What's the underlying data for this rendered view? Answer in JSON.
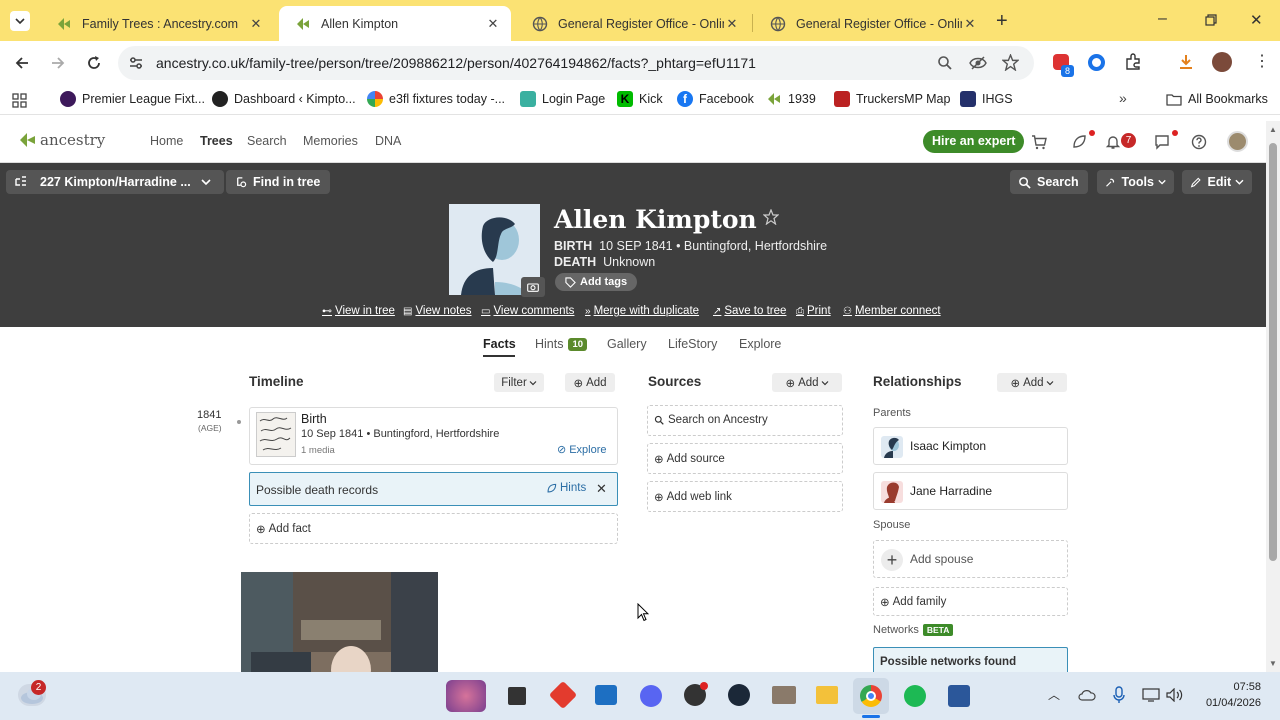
{
  "browser": {
    "tabs": [
      {
        "title": "Family Trees : Ancestry.com"
      },
      {
        "title": "Allen Kimpton"
      },
      {
        "title": "General Register Office - Online"
      },
      {
        "title": "General Register Office - Online"
      }
    ],
    "url": "ancestry.co.uk/family-tree/person/tree/209886212/person/402764194862/facts?_phtarg=efU1171",
    "extensions_badge": "8",
    "bookmarks": [
      "Premier League Fixt...",
      "Dashboard ‹ Kimpto...",
      "e3fl fixtures today -...",
      "Login Page",
      "Kick",
      "Facebook",
      "1939",
      "TruckersMP Map",
      "IHGS"
    ],
    "all_bookmarks": "All Bookmarks"
  },
  "ancestry": {
    "logo": "ancestry",
    "nav": [
      "Home",
      "Trees",
      "Search",
      "Memories",
      "DNA"
    ],
    "hire_expert": "Hire an expert",
    "notif_count": "7"
  },
  "hero": {
    "tree_name": "227 Kimpton/Harradine ...",
    "find_in_tree": "Find in tree",
    "search": "Search",
    "tools": "Tools",
    "edit": "Edit",
    "name": "Allen Kimpton",
    "birth_label": "BIRTH",
    "birth_value": "10 SEP 1841 • Buntingford, Hertfordshire",
    "death_label": "DEATH",
    "death_value": "Unknown",
    "add_tags": "Add tags",
    "links": [
      "View in tree",
      "View notes",
      "View comments",
      "Merge with duplicate",
      "Save to tree",
      "Print",
      "Member connect"
    ]
  },
  "subtabs": {
    "facts": "Facts",
    "hints": "Hints",
    "hints_count": "10",
    "gallery": "Gallery",
    "lifestory": "LifeStory",
    "explore": "Explore"
  },
  "timeline": {
    "title": "Timeline",
    "filter": "Filter",
    "add": "Add",
    "year": "1841",
    "age": "(AGE)",
    "event_title": "Birth",
    "event_detail": "10 Sep 1841 • Buntingford, Hertfordshire",
    "event_media": "1 media",
    "explore": "Explore",
    "possible": "Possible death records",
    "hints": "Hints",
    "add_fact": "Add fact"
  },
  "sources": {
    "title": "Sources",
    "add": "Add",
    "search": "Search on Ancestry",
    "add_source": "Add source",
    "add_link": "Add web link"
  },
  "relationships": {
    "title": "Relationships",
    "add": "Add",
    "parents_label": "Parents",
    "father": "Isaac Kimpton",
    "mother": "Jane Harradine",
    "spouse_label": "Spouse",
    "add_spouse": "Add spouse",
    "add_family": "Add family",
    "networks_label": "Networks",
    "beta": "BETA",
    "networks_found": "Possible networks found"
  },
  "taskbar": {
    "weather_badge": "2",
    "time": "07:58",
    "date": "01/04/2026"
  },
  "colors": {
    "tab_strip": "#fbe273",
    "ancestry_green": "#5b8a2c",
    "hero_bg": "#3e3e3e",
    "hint_bg": "#e9f3f8",
    "hint_border": "#3a8fb7",
    "expert_btn": "#3d8b29"
  }
}
